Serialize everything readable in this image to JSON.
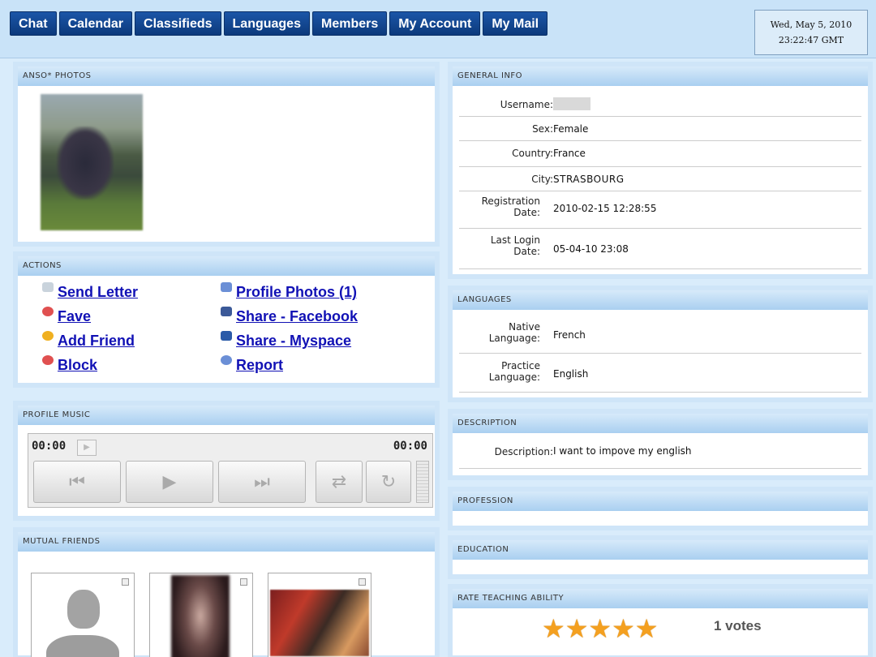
{
  "nav": {
    "tabs": [
      "Chat",
      "Calendar",
      "Classifieds",
      "Languages",
      "Members",
      "My Account",
      "My Mail"
    ]
  },
  "datetime": {
    "line1": "Wed, May 5, 2010",
    "line2": "23:22:47 GMT"
  },
  "photos": {
    "title": "ANSO* PHOTOS"
  },
  "actions": {
    "title": "ACTIONS",
    "items": [
      {
        "label": "Send Letter",
        "icon": "envelope-icon",
        "color": "#c9d3dc"
      },
      {
        "label": "Fave",
        "icon": "heart-icon",
        "color": "#e05050"
      },
      {
        "label": "Add Friend",
        "icon": "smiley-icon",
        "color": "#f0b020"
      },
      {
        "label": "Block",
        "icon": "block-icon",
        "color": "#e05050"
      },
      {
        "label": "Profile Photos (1)",
        "icon": "photos-icon",
        "color": "#6b8fd6"
      },
      {
        "label": "Share - Facebook",
        "icon": "facebook-icon",
        "color": "#3b5998"
      },
      {
        "label": "Share - Myspace",
        "icon": "myspace-icon",
        "color": "#2a5aa8"
      },
      {
        "label": "Report",
        "icon": "report-icon",
        "color": "#6b8fd6"
      }
    ]
  },
  "music": {
    "title": "PROFILE MUSIC",
    "time_start": "00:00",
    "time_end": "00:00"
  },
  "friends": {
    "title": "MUTUAL FRIENDS"
  },
  "general": {
    "title": "GENERAL INFO",
    "rows": [
      {
        "label": "Username:",
        "value": ""
      },
      {
        "label": "Sex:",
        "value": "Female"
      },
      {
        "label": "Country:",
        "value": "France"
      },
      {
        "label": "City:",
        "value": "STRASBOURG"
      },
      {
        "label": "Registration Date:",
        "value": "2010-02-15 12:28:55"
      },
      {
        "label": "Last Login Date:",
        "value": "05-04-10 23:08"
      }
    ]
  },
  "languages": {
    "title": "LANGUAGES",
    "rows": [
      {
        "label": "Native Language:",
        "value": "French"
      },
      {
        "label": "Practice Language:",
        "value": "English"
      }
    ]
  },
  "description": {
    "title": "DESCRIPTION",
    "label": "Description:",
    "value": "I want to impove my english"
  },
  "profession": {
    "title": "PROFESSION"
  },
  "education": {
    "title": "EDUCATION"
  },
  "rating": {
    "title": "RATE TEACHING ABILITY",
    "votes": "1 votes",
    "stars": 5
  }
}
